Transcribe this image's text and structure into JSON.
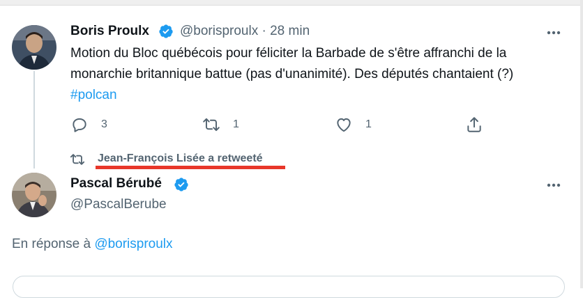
{
  "colors": {
    "accent": "#1d9bf0",
    "text": "#0f1419",
    "muted": "#536471",
    "annotation": "#e8372a"
  },
  "tweet1": {
    "author_name": "Boris Proulx",
    "handle": "@borisproulx",
    "separator": "·",
    "time": "28 min",
    "text_plain": "Motion du Bloc québécois pour féliciter la Barbade de s'être affranchi de la monarchie britannique battue (pas d'unanimité). Des députés chantaient (?) ",
    "hashtag": "#polcan",
    "reply_count": "3",
    "retweet_count": "1",
    "like_count": "1",
    "icons": [
      "verified-badge-icon",
      "more-icon",
      "reply-icon",
      "retweet-icon",
      "like-icon",
      "share-icon"
    ]
  },
  "retweet_notice": {
    "text": "Jean-François Lisée a retweeté",
    "icon": "retweet-icon"
  },
  "tweet2": {
    "author_name": "Pascal Bérubé",
    "handle": "@PascalBerube",
    "reply_prefix": "En réponse à ",
    "reply_handle": "@borisproulx",
    "icons": [
      "verified-badge-icon",
      "more-icon"
    ]
  }
}
